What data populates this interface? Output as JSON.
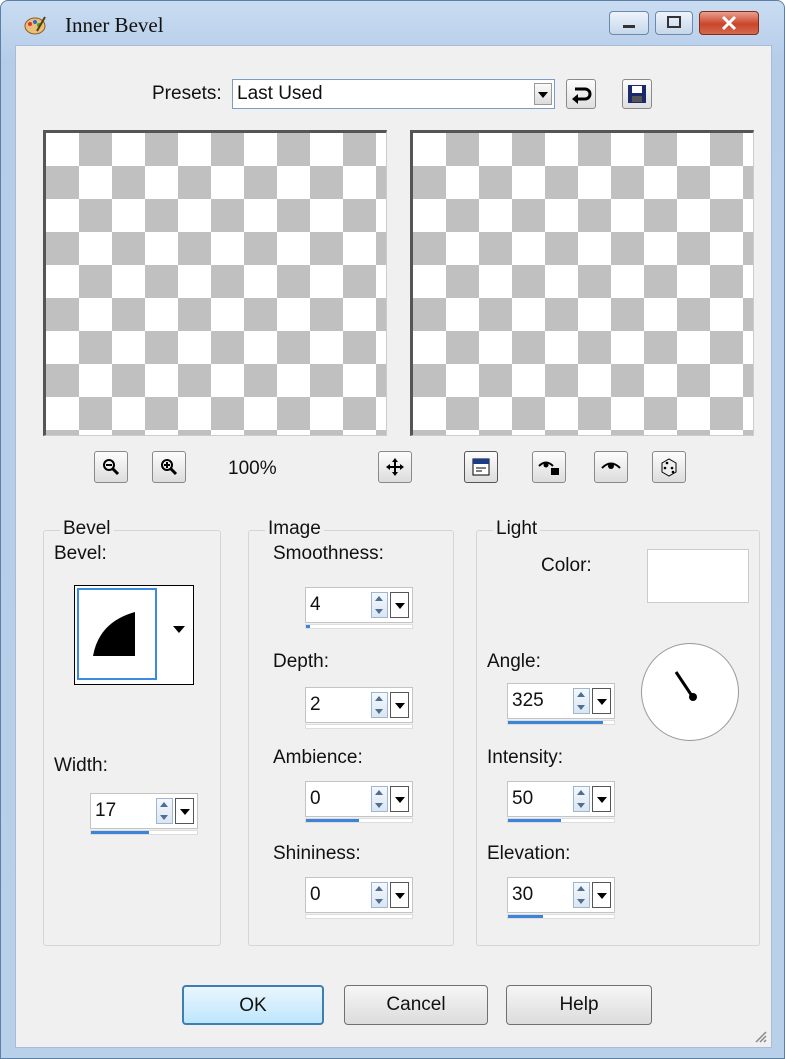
{
  "window": {
    "title": "Inner Bevel"
  },
  "presets": {
    "label": "Presets:",
    "value": "Last Used"
  },
  "preview": {
    "zoom_level": "100%"
  },
  "bevel": {
    "group_title": "Bevel",
    "bevel_label": "Bevel:",
    "width_label": "Width:",
    "width_value": "17",
    "width_fill": 0.55
  },
  "image": {
    "group_title": "Image",
    "smoothness_label": "Smoothness:",
    "smoothness_value": "4",
    "smoothness_fill": 0.04,
    "depth_label": "Depth:",
    "depth_value": "2",
    "depth_fill": 0.0,
    "ambience_label": "Ambience:",
    "ambience_value": "0",
    "ambience_fill": 0.5,
    "shininess_label": "Shininess:",
    "shininess_value": "0",
    "shininess_fill": 0.0
  },
  "light": {
    "group_title": "Light",
    "color_label": "Color:",
    "color": "#ffffff",
    "angle_label": "Angle:",
    "angle_value": "325",
    "angle_fill": 0.9,
    "intensity_label": "Intensity:",
    "intensity_value": "50",
    "intensity_fill": 0.5,
    "elevation_label": "Elevation:",
    "elevation_value": "30",
    "elevation_fill": 0.33
  },
  "buttons": {
    "ok": "OK",
    "cancel": "Cancel",
    "help": "Help"
  },
  "icons": [
    "app-icon",
    "minimize-icon",
    "maximize-icon",
    "close-icon",
    "reset-icon",
    "save-icon",
    "zoom-out-icon",
    "zoom-in-icon",
    "move-icon",
    "proof-icon",
    "randomize-icon"
  ]
}
